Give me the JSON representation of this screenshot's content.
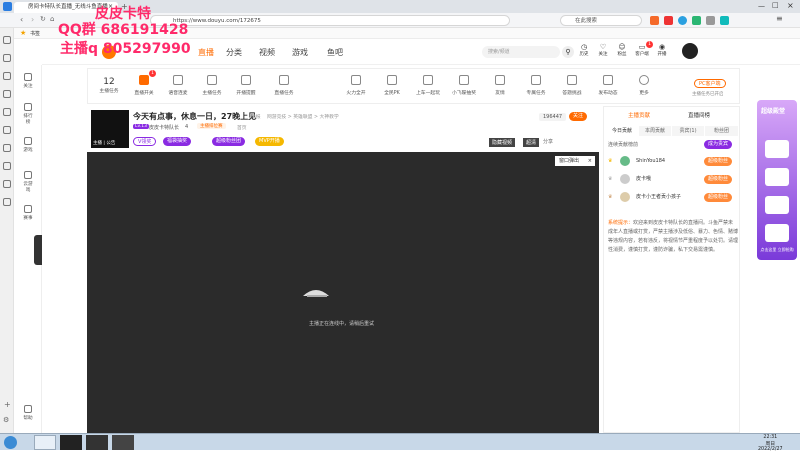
{
  "browser": {
    "tab_title": "房间卡特队长直播_无线斗鱼直播",
    "tab_close": "×",
    "new_tab": "+",
    "url": "https://www.douyu.com/172675",
    "search_placeholder": "在此搜索",
    "bookmark_label": "书签",
    "window_controls": [
      "—",
      "□",
      "×"
    ]
  },
  "watermark": {
    "line1": "皮皮卡特",
    "line2": "QQ群 686191428",
    "line3": "主播q 805297990"
  },
  "header": {
    "live_label": "直播",
    "nav": [
      "分类",
      "视频",
      "游戏",
      "鱼吧"
    ],
    "search_placeholder": "搜索/频道",
    "user_icons": [
      "历史",
      "关注",
      "粉丝",
      "客户端",
      "开播"
    ],
    "notification_count": "1"
  },
  "icon_bar": {
    "level_number": "12",
    "level_label": "主播任务",
    "items": [
      "直播开关",
      "语音连麦",
      "主播任务",
      "开播提醒",
      "直播任务",
      "火力全开",
      "全民PK",
      "上车一起玩",
      "小飞碟抽奖",
      "友情",
      "专属任务",
      "答题挑战",
      "发布动态",
      "更多"
    ],
    "badge": "1",
    "pc_button": "PC客户端",
    "pc_sub": "主播任务已开启"
  },
  "room": {
    "title": "今天有点事，休息一日，27晚上见",
    "report": "举报",
    "category": "网游竞技 > 英雄联盟 > 大神教学",
    "streamer_name": "皮皮卡特队长",
    "level": "Lv.13",
    "fans_count": "4",
    "online_text": "首页",
    "rank_badge": "主播排位赛",
    "follower_count": "196447",
    "follow_button": "关注",
    "share": "分享",
    "tags": [
      "V领奖",
      "福袋抽奖",
      "超级粉丝团",
      "MVP开播"
    ],
    "video_toggle": "隐藏视频",
    "quality": "超清",
    "popout_button": "窗口弹出",
    "popout_close": "×",
    "avatar_caption": "主播 | 公告"
  },
  "player": {
    "loading_text": "主播正在连线中，请稍后重试"
  },
  "right_panel": {
    "top_tabs": [
      "主播贡献",
      "直播间榜"
    ],
    "sub_tabs": [
      "今日贡献",
      "本周贡献",
      "贵宾(1)",
      "粉丝团"
    ],
    "rank_title": "连续贡献榜前",
    "become_fan": "成为贵宾",
    "ranks": [
      {
        "name": "ShinYou184",
        "badge": "超级粉丝"
      },
      {
        "name": "皮卡哦",
        "badge": "超级粉丝"
      },
      {
        "name": "皮卡小王者贡小孩子",
        "badge": "超级粉丝"
      }
    ],
    "system_label": "系统提示：",
    "system_text": "欢迎来到皮皮卡特队长的直播间。斗鱼严禁未成年人直播或打赏，严禁主播涉及低俗、暴力、色情、赌博等违规内容，若有违反，将视情节严重程度予以处罚。请理性消费，谨慎打赏，谨防诈骗，私下交易需谨慎。"
  },
  "side_ad": {
    "title": "超级殿堂",
    "items": [
      "火箭主",
      "超级飞车",
      "飞机",
      "火箭"
    ],
    "footer": "点击这里 立即抢购"
  },
  "sidebar": {
    "items": [
      "关注",
      "排行榜",
      "游戏",
      "云游戏",
      "赛事"
    ],
    "bottom": [
      "帮助"
    ]
  },
  "taskbar": {
    "time": "22:31",
    "day": "周日",
    "date": "2022/2/27"
  },
  "colors": {
    "accent": "#ff6a00",
    "video_bg": "#2b2b2b",
    "watermark": "#ff2a6a",
    "purple": "#8a2be2"
  }
}
